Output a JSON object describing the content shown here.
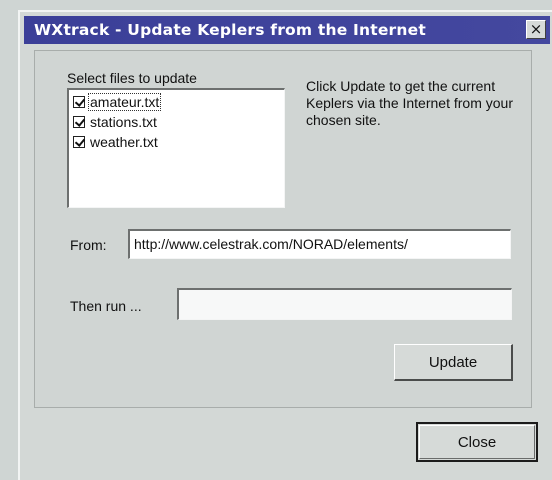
{
  "window": {
    "title": "WXtrack - Update Keplers from the Internet",
    "close_glyph": "×"
  },
  "files_section": {
    "label": "Select files to update",
    "items": [
      {
        "label": "amateur.txt",
        "checked": true
      },
      {
        "label": "stations.txt",
        "checked": true
      },
      {
        "label": "weather.txt",
        "checked": true
      }
    ]
  },
  "info": {
    "text": "Click Update to get the current Keplers via the Internet from your chosen site."
  },
  "from": {
    "label": "From:",
    "value": "http://www.celestrak.com/NORAD/elements/"
  },
  "then_run": {
    "label": "Then run ...",
    "value": ""
  },
  "buttons": {
    "update_label": "Update",
    "close_label": "Close"
  },
  "colors": {
    "title_bar": "#3b3f98",
    "window_bg": "#d3d8d6"
  }
}
